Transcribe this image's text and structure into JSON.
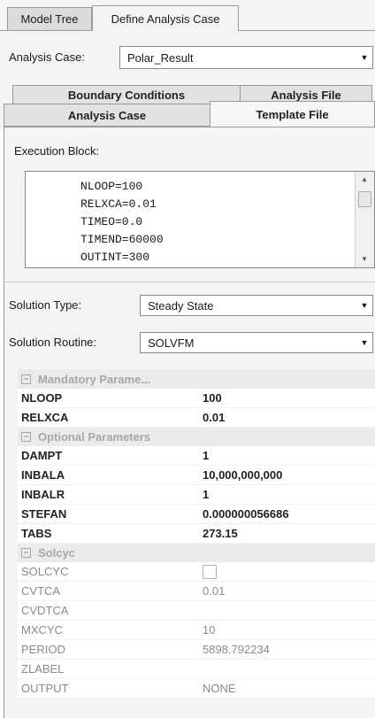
{
  "top_tabs": [
    "Model Tree",
    "Define Analysis Case"
  ],
  "analysis_case": {
    "label": "Analysis Case:",
    "value": "Polar_Result"
  },
  "panel_tabs": {
    "row_back": [
      "Boundary Conditions",
      "Analysis File"
    ],
    "row_front": [
      "Analysis Case",
      "Template File"
    ]
  },
  "execution_block": {
    "label": "Execution Block:",
    "lines": [
      "NLOOP=100",
      "RELXCA=0.01",
      "TIMEO=0.0",
      "TIMEND=60000",
      "OUTINT=300"
    ]
  },
  "solution_type": {
    "label": "Solution Type:",
    "value": "Steady State"
  },
  "solution_routine": {
    "label": "Solution Routine:",
    "value": "SOLVFM"
  },
  "sections": {
    "mandatory": "Mandatory Parame...",
    "optional": "Optional Parameters",
    "solcyc": "Solcyc"
  },
  "mandatory_rows": [
    {
      "k": "NLOOP",
      "v": "100"
    },
    {
      "k": "RELXCA",
      "v": "0.01"
    }
  ],
  "optional_rows": [
    {
      "k": "DAMPT",
      "v": "1"
    },
    {
      "k": "INBALA",
      "v": "10,000,000,000"
    },
    {
      "k": "INBALR",
      "v": "1"
    },
    {
      "k": "STEFAN",
      "v": "0.000000056686"
    },
    {
      "k": "TABS",
      "v": "273.15"
    }
  ],
  "solcyc_rows": [
    {
      "k": "SOLCYC",
      "v": ""
    },
    {
      "k": "CVTCA",
      "v": "0.01"
    },
    {
      "k": "CVDTCA",
      "v": ""
    },
    {
      "k": "MXCYC",
      "v": "10"
    },
    {
      "k": "PERIOD",
      "v": "5898.792234"
    },
    {
      "k": "ZLABEL",
      "v": ""
    },
    {
      "k": "OUTPUT",
      "v": "NONE"
    }
  ],
  "icons": {
    "combo_arrow": "▼",
    "scroll_up": "▲",
    "scroll_down": "▼",
    "collapse": "⊟"
  }
}
